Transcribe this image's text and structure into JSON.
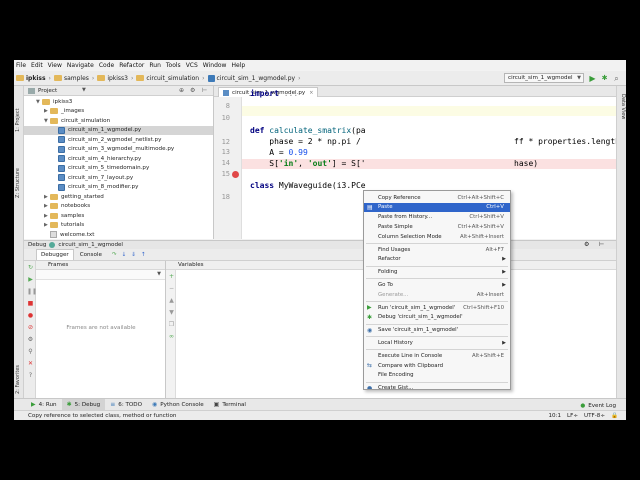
{
  "colors": {
    "accent": "#2f65ca",
    "breakpoint": "#e04848",
    "run": "#4caf50"
  },
  "menubar": [
    "File",
    "Edit",
    "View",
    "Navigate",
    "Code",
    "Refactor",
    "Run",
    "Tools",
    "VCS",
    "Window",
    "Help"
  ],
  "breadcrumbs": [
    "ipkiss",
    "samples",
    "ipkiss3",
    "circuit_simulation",
    "circuit_sim_1_wgmodel.py"
  ],
  "run_config": "circuit_sim_1_wgmodel",
  "sidebar_tabs": {
    "project": "1: Project",
    "structure": "Z: Structure",
    "favorites": "2: Favorites",
    "dataview": "Data View"
  },
  "project_panel": {
    "title": "Project",
    "tree": [
      {
        "label": "ipkiss3",
        "type": "folder",
        "indent": 1,
        "expanded": true
      },
      {
        "label": "_images",
        "type": "folder",
        "indent": 2,
        "expanded": false
      },
      {
        "label": "circuit_simulation",
        "type": "folder",
        "indent": 2,
        "expanded": true
      },
      {
        "label": "circuit_sim_1_wgmodel.py",
        "type": "py",
        "indent": 3,
        "selected": true
      },
      {
        "label": "circuit_sim_2_wgmodel_netlist.py",
        "type": "py",
        "indent": 3
      },
      {
        "label": "circuit_sim_3_wgmodel_multimode.py",
        "type": "py",
        "indent": 3
      },
      {
        "label": "circuit_sim_4_hierarchy.py",
        "type": "py",
        "indent": 3
      },
      {
        "label": "circuit_sim_5_timedomain.py",
        "type": "py",
        "indent": 3
      },
      {
        "label": "circuit_sim_7_layout.py",
        "type": "py",
        "indent": 3
      },
      {
        "label": "circuit_sim_8_modifier.py",
        "type": "py",
        "indent": 3
      },
      {
        "label": "getting_started",
        "type": "folder",
        "indent": 2
      },
      {
        "label": "notebooks",
        "type": "folder",
        "indent": 2
      },
      {
        "label": "samples",
        "type": "folder",
        "indent": 2
      },
      {
        "label": "tutorials",
        "type": "folder",
        "indent": 2
      },
      {
        "label": "welcome.txt",
        "type": "txt",
        "indent": 2
      }
    ]
  },
  "editor": {
    "tab": "circuit_sim_1_wgmodel.py",
    "line_numbers": [
      "8",
      "10",
      "12",
      "13",
      "14",
      "15",
      "18"
    ],
    "code": {
      "import_kw": "import",
      "import_rest": " ...",
      "def_kw": "def",
      "def_fn": " calculate_smatrix",
      "def_rest": "(pa",
      "phase": "    phase = 2 * np.pi /",
      "phase_tail": "ff * properties.length",
      "a_line": "    A = ",
      "a_val": "0.99",
      "s_pre": "    S[",
      "s_in": "'in'",
      "s_mid": ", ",
      "s_out": "'out'",
      "s_post": "] = S['",
      "s_tail": "hase)",
      "class_kw": "class",
      "class_rest": " MyWaveguide(i3.PCe"
    }
  },
  "context_menu": {
    "items": [
      {
        "label": "Copy Reference",
        "shortcut": "Ctrl+Alt+Shift+C"
      },
      {
        "label": "Paste",
        "shortcut": "Ctrl+V",
        "selected": true,
        "icon": "clipboard-icon"
      },
      {
        "label": "Paste from History...",
        "shortcut": "Ctrl+Shift+V"
      },
      {
        "label": "Paste Simple",
        "shortcut": "Ctrl+Alt+Shift+V"
      },
      {
        "label": "Column Selection Mode",
        "shortcut": "Alt+Shift+Insert"
      },
      {
        "separator": true
      },
      {
        "label": "Find Usages",
        "shortcut": "Alt+F7"
      },
      {
        "label": "Refactor",
        "submenu": true
      },
      {
        "separator": true
      },
      {
        "label": "Folding",
        "submenu": true
      },
      {
        "separator": true
      },
      {
        "label": "Go To",
        "submenu": true
      },
      {
        "label": "Generate...",
        "shortcut": "Alt+Insert",
        "disabled": true
      },
      {
        "separator": true
      },
      {
        "label": "Run 'circuit_sim_1_wgmodel'",
        "shortcut": "Ctrl+Shift+F10",
        "icon": "run-icon"
      },
      {
        "label": "Debug 'circuit_sim_1_wgmodel'",
        "icon": "debug-icon"
      },
      {
        "separator": true
      },
      {
        "label": "Save 'circuit_sim_1_wgmodel'",
        "icon": "python-icon"
      },
      {
        "separator": true
      },
      {
        "label": "Local History",
        "submenu": true
      },
      {
        "separator": true
      },
      {
        "label": "Execute Line in Console",
        "shortcut": "Alt+Shift+E"
      },
      {
        "label": "Compare with Clipboard",
        "icon": "compare-icon"
      },
      {
        "label": "File Encoding"
      },
      {
        "separator": true
      },
      {
        "label": "Create Gist...",
        "icon": "github-icon"
      }
    ]
  },
  "debug": {
    "title_prefix": "Debug",
    "config": "circuit_sim_1_wgmodel",
    "tabs": [
      "Debugger",
      "Console"
    ],
    "frames_label": "Frames",
    "variables_label": "Variables",
    "frames_empty": "Frames are not available"
  },
  "bottom_tools": [
    {
      "label": "4: Run",
      "icon": "run-icon"
    },
    {
      "label": "5: Debug",
      "icon": "debug-icon",
      "active": true
    },
    {
      "label": "6: TODO",
      "icon": "todo-icon"
    },
    {
      "label": "Python Console",
      "icon": "python-icon"
    },
    {
      "label": "Terminal",
      "icon": "terminal-icon"
    }
  ],
  "event_log": "Event Log",
  "status": {
    "message": "Copy reference to selected class, method or function",
    "position": "10:1",
    "line_sep": "LF÷",
    "encoding": "UTF-8÷"
  }
}
